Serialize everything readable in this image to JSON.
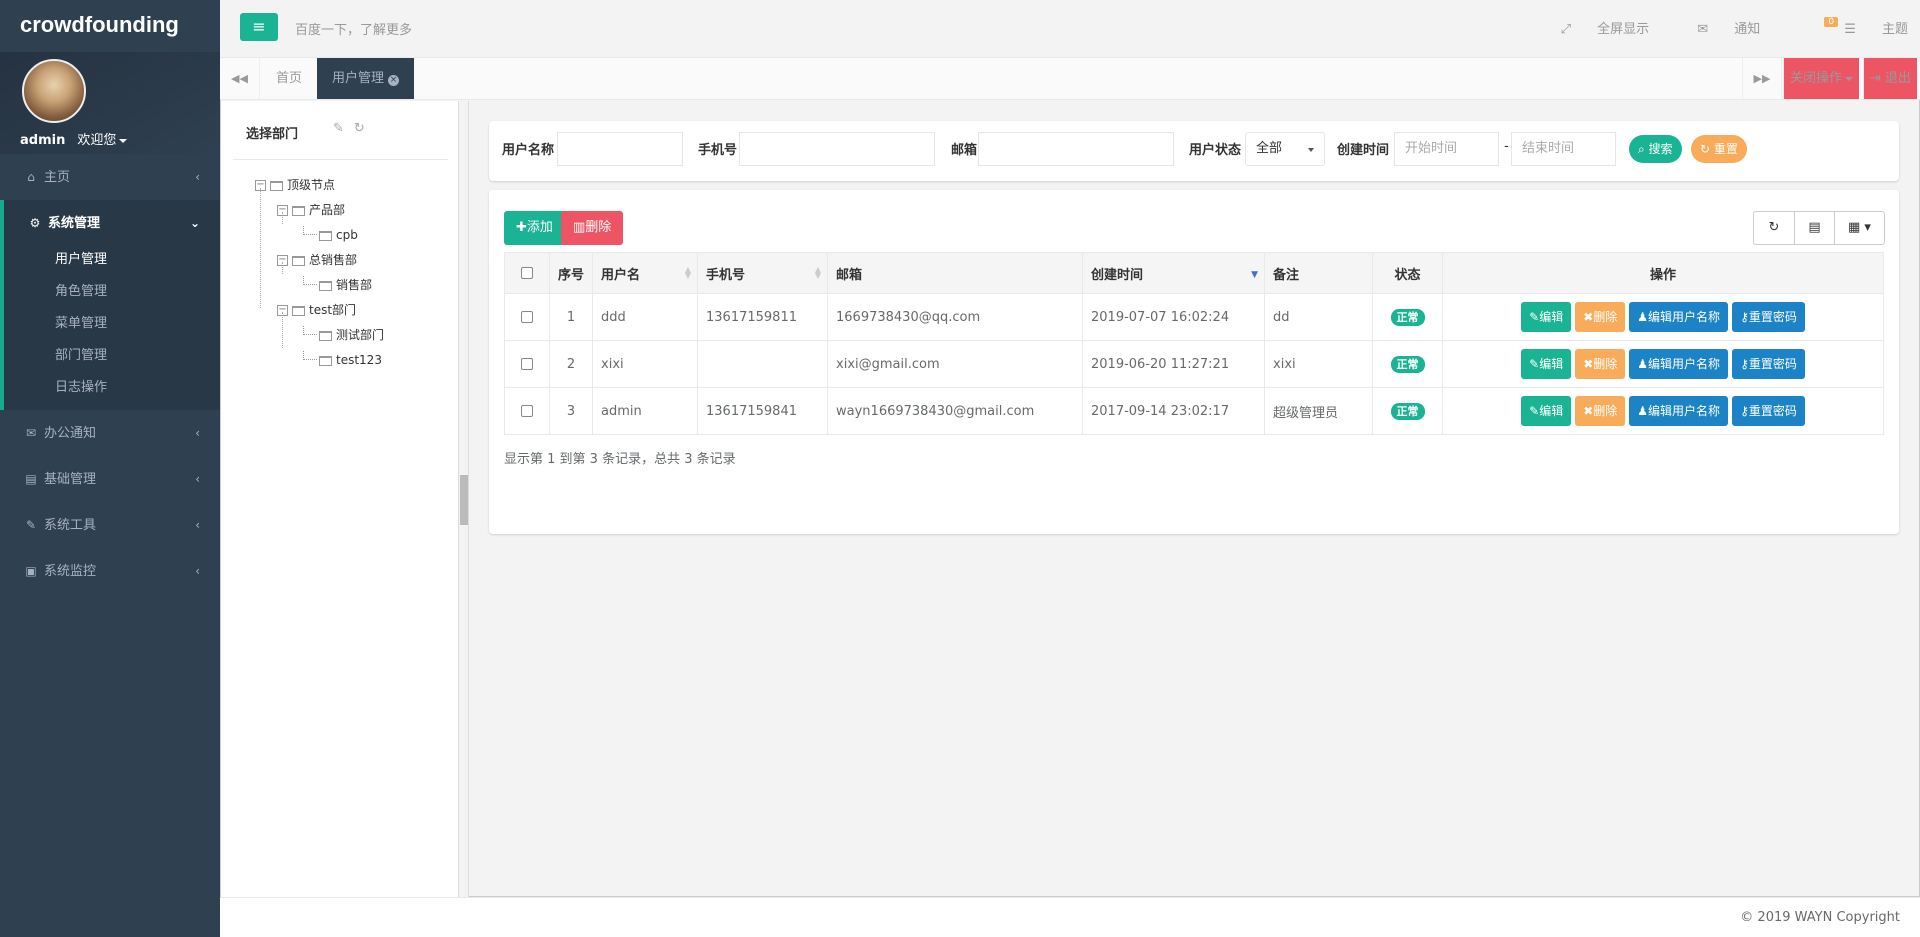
{
  "sidebar": {
    "brand": "crowdfounding",
    "user": "admin",
    "welcome": "欢迎您",
    "menu": [
      {
        "label": "主页",
        "icon": "home-icon"
      },
      {
        "label": "系统管理",
        "icon": "gears-icon",
        "children": [
          "用户管理",
          "角色管理",
          "菜单管理",
          "部门管理",
          "日志操作"
        ],
        "current": "用户管理"
      },
      {
        "label": "办公通知",
        "icon": "envelope-icon"
      },
      {
        "label": "基础管理",
        "icon": "id-card-icon"
      },
      {
        "label": "系统工具",
        "icon": "wrench-icon"
      },
      {
        "label": "系统监控",
        "icon": "monitor-icon"
      }
    ]
  },
  "topbar": {
    "search_hint": "百度一下，了解更多",
    "fullscreen": "全屏显示",
    "notice": "通知",
    "notice_count": "0",
    "theme": "主题"
  },
  "tabs": {
    "items": [
      "首页",
      "用户管理"
    ],
    "close_ops": "关闭操作",
    "logout": "退出"
  },
  "dept_panel": {
    "title": "选择部门",
    "tree": [
      {
        "label": "顶级节点"
      },
      {
        "label": "产品部"
      },
      {
        "label": "cpb"
      },
      {
        "label": "总销售部"
      },
      {
        "label": "销售部"
      },
      {
        "label": "test部门"
      },
      {
        "label": "测试部门"
      },
      {
        "label": "test123"
      }
    ]
  },
  "search": {
    "username_label": "用户名称",
    "phone_label": "手机号",
    "email_label": "邮箱",
    "status_label": "用户状态",
    "status_value": "全部",
    "time_label": "创建时间",
    "start_placeholder": "开始时间",
    "end_placeholder": "结束时间",
    "dash": "-",
    "search_btn": "搜索",
    "reset_btn": "重置"
  },
  "toolbar": {
    "add": "添加",
    "delete": "删除"
  },
  "table": {
    "headers": [
      "序号",
      "用户名",
      "手机号",
      "邮箱",
      "创建时间",
      "备注",
      "状态",
      "操作"
    ],
    "rows": [
      {
        "no": "1",
        "username": "ddd",
        "phone": "13617159811",
        "email": "1669738430@qq.com",
        "created": "2019-07-07 16:02:24",
        "remark": "dd",
        "status": "正常"
      },
      {
        "no": "2",
        "username": "xixi",
        "phone": "",
        "email": "xixi@gmail.com",
        "created": "2019-06-20 11:27:21",
        "remark": "xixi",
        "status": "正常"
      },
      {
        "no": "3",
        "username": "admin",
        "phone": "13617159841",
        "email": "wayn1669738430@gmail.com",
        "created": "2017-09-14 23:02:17",
        "remark": "超级管理员",
        "status": "正常"
      }
    ],
    "ops": {
      "edit": "编辑",
      "del": "删除",
      "edit_name": "编辑用户名称",
      "reset_pwd": "重置密码"
    }
  },
  "pager": "显示第 1 到第 3 条记录，总共 3 条记录",
  "footer": "© 2019 WAYN Copyright",
  "colors": {
    "sidebar": "#2f4050",
    "primary": "#1ab394",
    "warning": "#f8ac59",
    "info": "#1c84c6",
    "danger": "#ed5565"
  }
}
